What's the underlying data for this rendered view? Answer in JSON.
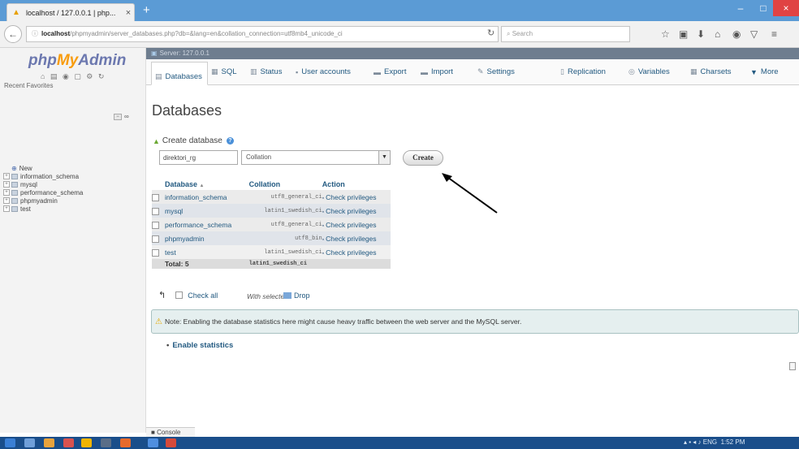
{
  "browser": {
    "tab_title": "localhost / 127.0.0.1 | php...",
    "new_tab": "+",
    "url_host": "localhost",
    "url_rest": "/phpmyadmin/server_databases.php?db=&lang=en&collation_connection=utf8mb4_unicode_ci",
    "search_placeholder": "Search",
    "window_controls": {
      "minimize": "–",
      "maximize": "□",
      "close": "×"
    }
  },
  "sidebar": {
    "logo": {
      "php": "php",
      "my": "My",
      "admin": "Admin"
    },
    "recent_favorites": "Recent  Favorites",
    "tree": [
      {
        "label": "New"
      },
      {
        "label": "information_schema"
      },
      {
        "label": "mysql"
      },
      {
        "label": "performance_schema"
      },
      {
        "label": "phpmyadmin"
      },
      {
        "label": "test"
      }
    ]
  },
  "server_bar": {
    "label": "Server: 127.0.0.1"
  },
  "menu": {
    "tabs": [
      {
        "label": "Databases"
      },
      {
        "label": "SQL"
      },
      {
        "label": "Status"
      },
      {
        "label": "User accounts"
      },
      {
        "label": "Export"
      },
      {
        "label": "Import"
      },
      {
        "label": "Settings"
      },
      {
        "label": "Replication"
      },
      {
        "label": "Variables"
      },
      {
        "label": "Charsets"
      },
      {
        "label": "More"
      }
    ]
  },
  "main": {
    "title": "Databases",
    "create_label": "Create database",
    "db_name_value": "direktori_rg",
    "collation_placeholder": "Collation",
    "create_button": "Create",
    "table": {
      "headers": {
        "database": "Database",
        "sort_icon": "▲",
        "collation": "Collation",
        "action": "Action"
      },
      "rows": [
        {
          "name": "information_schema",
          "collation": "utf8_general_ci",
          "action": "Check privileges"
        },
        {
          "name": "mysql",
          "collation": "latin1_swedish_ci",
          "action": "Check privileges"
        },
        {
          "name": "performance_schema",
          "collation": "utf8_general_ci",
          "action": "Check privileges"
        },
        {
          "name": "phpmyadmin",
          "collation": "utf8_bin",
          "action": "Check privileges"
        },
        {
          "name": "test",
          "collation": "latin1_swedish_ci",
          "action": "Check privileges"
        }
      ],
      "total_label": "Total: 5",
      "total_collation": "latin1_swedish_ci"
    },
    "check_all": "Check all",
    "with_selected": "With selected:",
    "drop": "Drop",
    "notice": "Note: Enabling the database statistics here might cause heavy traffic between the web server and the MySQL server.",
    "enable_statistics": "Enable statistics",
    "console": "Console"
  },
  "taskbar": {
    "lang": "ENG",
    "time": "1:52 PM"
  },
  "colors": {
    "link": "#235a81",
    "titlebar": "#5b9bd5",
    "taskbar": "#1a4e8a",
    "server_bar": "#6e7d8f"
  }
}
